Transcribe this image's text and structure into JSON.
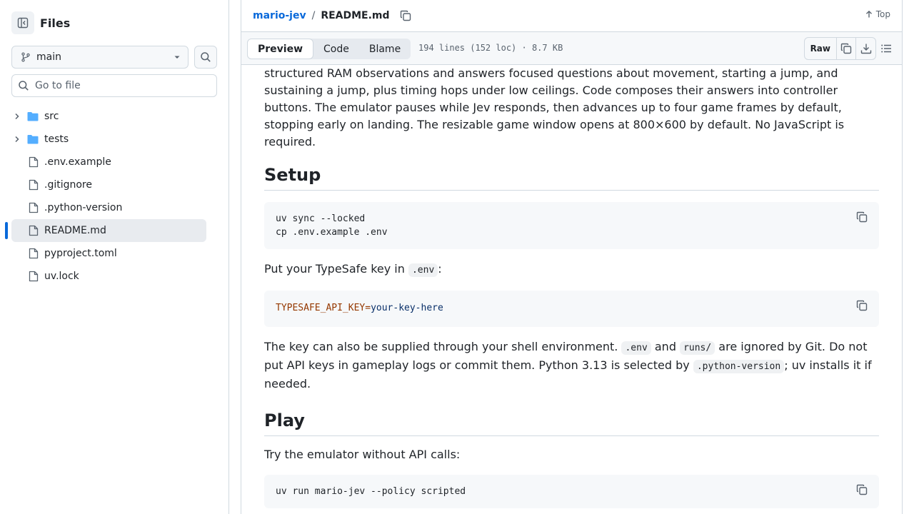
{
  "sidebar": {
    "title": "Files",
    "branch": "main",
    "goto_placeholder": "Go to file",
    "items": [
      {
        "label": "src",
        "type": "folder"
      },
      {
        "label": "tests",
        "type": "folder"
      },
      {
        "label": ".env.example",
        "type": "file"
      },
      {
        "label": ".gitignore",
        "type": "file"
      },
      {
        "label": ".python-version",
        "type": "file"
      },
      {
        "label": "README.md",
        "type": "file",
        "selected": true
      },
      {
        "label": "pyproject.toml",
        "type": "file"
      },
      {
        "label": "uv.lock",
        "type": "file"
      }
    ]
  },
  "breadcrumb": {
    "repo": "mario-jev",
    "separator": "/",
    "file": "README.md",
    "top_label": "Top"
  },
  "file_header": {
    "tabs": [
      "Preview",
      "Code",
      "Blame"
    ],
    "active_tab": "Preview",
    "info": "194 lines (152 loc) · 8.7 KB",
    "raw_label": "Raw"
  },
  "content": {
    "intro_lines": [
      "structured RAM observations and answers focused questions about movement, starting a jump, and",
      "sustaining a jump, plus timing hops under low ceilings. Code composes their answers into controller",
      "buttons. The emulator pauses while Jev responds, then advances up to four game frames by default,",
      "stopping early on landing. The resizable game window opens at 800×600 by default. No JavaScript is",
      "required."
    ],
    "setup": {
      "heading": "Setup",
      "code1": [
        "uv sync --locked",
        "cp .env.example .env"
      ],
      "key_text_before": "Put your TypeSafe key in ",
      "key_code": ".env",
      "key_text_after": ":",
      "env_key": "TYPESAFE_API_KEY=",
      "env_value": "your-key-here",
      "p2_a": "The key can also be supplied through your shell environment. ",
      "p2_code1": ".env",
      "p2_and": " and ",
      "p2_code2": "runs/",
      "p2_b": " are ignored by Git. Do not",
      "p2_line2a": "put API keys in gameplay logs or commit them. Python 3.13 is selected by ",
      "p2_code3": ".python-version",
      "p2_line2b": "; uv installs it if",
      "p2_line3": "needed."
    },
    "play": {
      "heading": "Play",
      "text": "Try the emulator without API calls:",
      "code": "uv run mario-jev --policy scripted"
    }
  },
  "colors": {
    "accent": "#0969da",
    "border": "#d1d9e0",
    "folder": "#54aeff",
    "muted": "#59636e"
  }
}
